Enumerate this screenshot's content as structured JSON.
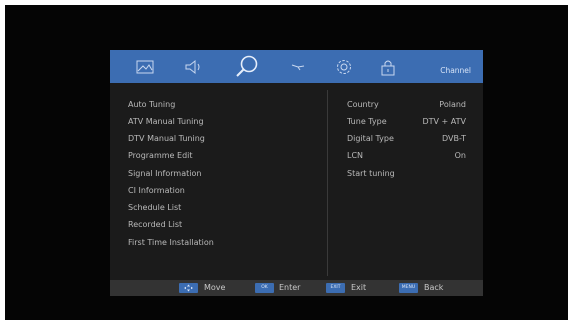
{
  "header": {
    "category": "Channel",
    "icons": [
      "picture-icon",
      "sound-icon",
      "search-icon",
      "time-icon",
      "setup-icon",
      "lock-icon"
    ]
  },
  "menu": {
    "items": [
      {
        "label": "Auto Tuning"
      },
      {
        "label": "ATV Manual Tuning"
      },
      {
        "label": "DTV Manual Tuning"
      },
      {
        "label": "Programme Edit"
      },
      {
        "label": "Signal Information"
      },
      {
        "label": "CI Information"
      },
      {
        "label": "Schedule List"
      },
      {
        "label": "Recorded List"
      },
      {
        "label": "First Time Installation"
      }
    ]
  },
  "settings": {
    "rows": [
      {
        "label": "Country",
        "value": "Poland"
      },
      {
        "label": "Tune Type",
        "value": "DTV + ATV"
      },
      {
        "label": "Digital Type",
        "value": "DVB-T"
      },
      {
        "label": "LCN",
        "value": "On"
      },
      {
        "label": "Start tuning",
        "value": ""
      }
    ]
  },
  "footer": {
    "move": {
      "key": "",
      "label": "Move"
    },
    "enter": {
      "key": "OK",
      "label": "Enter"
    },
    "exit": {
      "key": "EXIT",
      "label": "Exit"
    },
    "back": {
      "key": "MENU",
      "label": "Back"
    }
  },
  "colors": {
    "accent": "#3c6db2",
    "panel": "#1b1b1b",
    "footer": "#333333"
  }
}
